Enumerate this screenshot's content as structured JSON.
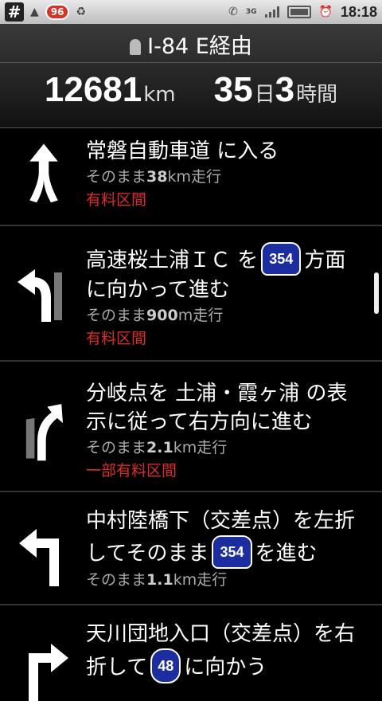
{
  "status_bar": {
    "notifications": [
      "#",
      "96"
    ],
    "time": "18:18",
    "network": "3G"
  },
  "header": {
    "route_title": "I-84 E経由",
    "distance_value": "12681",
    "distance_unit": "km",
    "duration_days": "35",
    "duration_days_unit": "日",
    "duration_hours": "3",
    "duration_hours_unit": "時間"
  },
  "steps": [
    {
      "icon": "merge-arrow-icon",
      "title_pre": "常磐自動車道 に入る",
      "distance_prefix": "そのまま",
      "distance_value": "38",
      "distance_suffix": "km走行",
      "toll": "有料区間"
    },
    {
      "icon": "turn-left-arrow-icon",
      "title_pre": "高速桜土浦ＩＣ を",
      "shield": "354",
      "title_post": "方面に向かって進む",
      "distance_prefix": "そのまま",
      "distance_value": "900",
      "distance_suffix": "m走行",
      "toll": "有料区間"
    },
    {
      "icon": "fork-right-arrow-icon",
      "title_pre": "分岐点を 土浦・霞ヶ浦 の表示に従って右方向に進む",
      "distance_prefix": "そのまま",
      "distance_value": "2.1",
      "distance_suffix": "km走行",
      "toll": "一部有料区間"
    },
    {
      "icon": "turn-left-sharp-arrow-icon",
      "title_pre": "中村陸橋下（交差点）を左折してそのまま",
      "shield": "354",
      "title_post": "を進む",
      "distance_prefix": "そのまま",
      "distance_value": "1.1",
      "distance_suffix": "km走行"
    },
    {
      "icon": "turn-right-arrow-icon",
      "title_pre": "天川団地入口（交差点）を右折して",
      "shield": "48",
      "title_post": "に向かう"
    }
  ]
}
